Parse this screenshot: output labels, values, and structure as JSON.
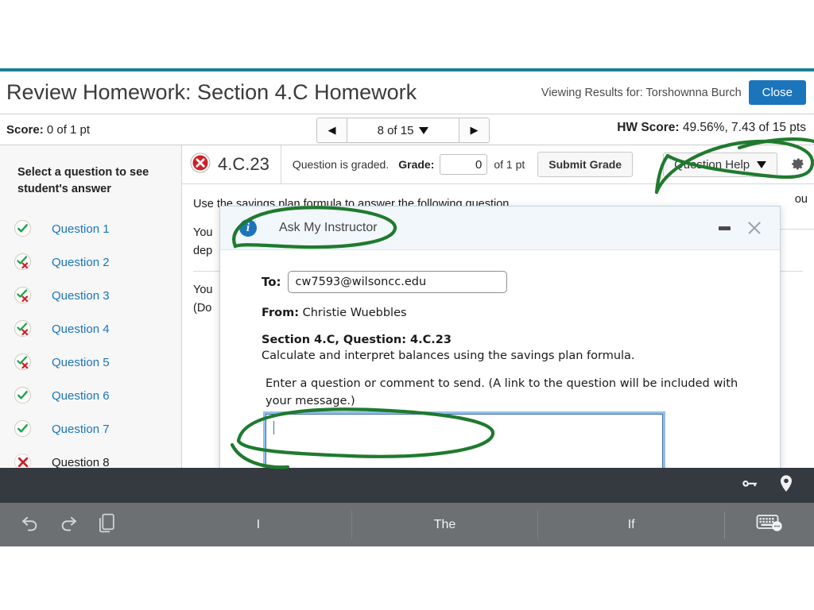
{
  "header": {
    "title": "Review Homework: Section 4.C Homework",
    "viewing_for": "Viewing Results for: Torshownna Burch",
    "close_label": "Close"
  },
  "score_bar": {
    "score_label": "Score:",
    "score_value": "0 of 1 pt",
    "pager_prev_icon": "triangle-left-icon",
    "pager_next_icon": "triangle-right-icon",
    "pager_label": "8 of 15",
    "hw_score_label": "HW Score:",
    "hw_score_value": "49.56%, 7.43 of 15 pts"
  },
  "sidebar": {
    "heading": "Select a question to see student's answer",
    "items": [
      {
        "label": "Question 1",
        "status": "correct"
      },
      {
        "label": "Question 2",
        "status": "partial"
      },
      {
        "label": "Question 3",
        "status": "partial"
      },
      {
        "label": "Question 4",
        "status": "partial"
      },
      {
        "label": "Question 5",
        "status": "partial"
      },
      {
        "label": "Question 6",
        "status": "correct"
      },
      {
        "label": "Question 7",
        "status": "correct"
      },
      {
        "label": "Question 8",
        "status": "incorrect"
      }
    ]
  },
  "question_toolbar": {
    "status_icon": "red-x-circle-icon",
    "question_number": "4.C.23",
    "graded_text": "Question is graded.",
    "grade_label": "Grade:",
    "grade_value": "0",
    "of_points": "of 1 pt",
    "submit_grade_label": "Submit Grade",
    "question_help_label": "Question Help",
    "gear_icon": "gear-icon"
  },
  "question_body": {
    "prompt": "Use the savings plan formula to answer the following question.",
    "line_a_visible": "You",
    "line_a_visible2": "dep",
    "line_b_visible": "You",
    "line_b_visible2": "(Do",
    "right_fragment": "ou"
  },
  "modal": {
    "title": "Ask My Instructor",
    "info_icon": "info-circle-icon",
    "minimize_icon": "minimize-icon",
    "close_icon": "close-x-icon",
    "to_label": "To:",
    "to_value": "cw7593@wilsoncc.edu",
    "from_label": "From:",
    "from_value": "Christie Wuebbles",
    "section_line": "Section 4.C, Question: 4.C.23",
    "section_desc": "Calculate and interpret balances using the savings plan formula.",
    "enter_hint": "Enter a question or comment to send. (A link to the question will be included with your message.)",
    "message_value": ""
  },
  "system_bar": {
    "icons": [
      "key-icon",
      "location-pin-icon"
    ]
  },
  "keyboard_bar": {
    "left_icons": [
      "undo-icon",
      "redo-icon",
      "clipboard-icon"
    ],
    "suggestions": [
      "I",
      "The",
      "If"
    ],
    "right_icon": "keyboard-settings-icon"
  },
  "colors": {
    "teal_rule": "#1a7f96",
    "link_blue": "#1b75bb",
    "primary_button": "#1b75bb",
    "annotation_green": "#1f7a2e",
    "correct_green": "#19a34a",
    "incorrect_red": "#cf2027",
    "sysbar_dark": "#343a40",
    "keyboard_gray": "#6d7073"
  }
}
